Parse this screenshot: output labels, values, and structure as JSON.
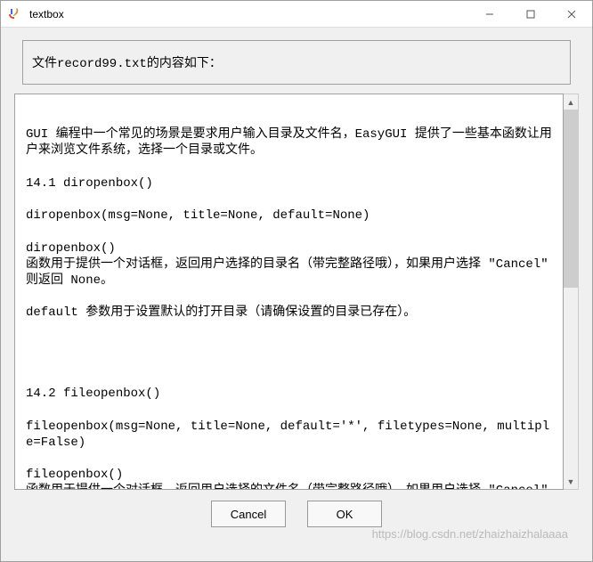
{
  "window": {
    "title": "textbox"
  },
  "msg": "文件record99.txt的内容如下：",
  "text_content": "\nGUI 编程中一个常见的场景是要求用户输入目录及文件名，EasyGUI 提供了一些基本函数让用户来浏览文件系统，选择一个目录或文件。\n\n14.1 diropenbox()\n\ndiropenbox(msg=None, title=None, default=None)\n\ndiropenbox()\n函数用于提供一个对话框，返回用户选择的目录名（带完整路径哦），如果用户选择 \"Cancel\" 则返回 None。\n\ndefault 参数用于设置默认的打开目录（请确保设置的目录已存在）。\n\n\n\n\n14.2 fileopenbox()\n\nfileopenbox(msg=None, title=None, default='*', filetypes=None, multiple=False)\n\nfileopenbox()\n函数用于提供一个对话框，返回用户选择的文件名（带完整路径哦），如果用户选择 \"Cancel\" 则返回 None。",
  "buttons": {
    "cancel": "Cancel",
    "ok": "OK"
  },
  "watermark": "https://blog.csdn.net/zhaizhaizhalaaaa"
}
